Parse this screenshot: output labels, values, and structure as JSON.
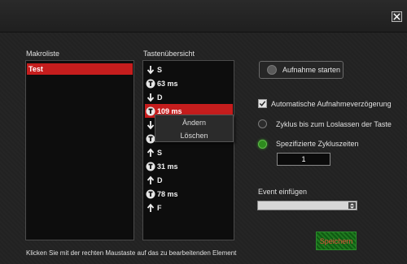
{
  "window": {
    "close_icon": "close-icon"
  },
  "makroliste": {
    "label": "Makroliste",
    "items": [
      "Test"
    ]
  },
  "tasten": {
    "label": "Tastenübersicht",
    "rows": [
      {
        "icon": "arrow-down-icon",
        "text": "S"
      },
      {
        "icon": "timer-icon",
        "text": "63 ms"
      },
      {
        "icon": "arrow-down-icon",
        "text": "D"
      },
      {
        "icon": "timer-icon",
        "text": "109 ms",
        "selected": true
      },
      {
        "icon": "arrow-down-icon",
        "text": ""
      },
      {
        "icon": "timer-icon",
        "text": ""
      },
      {
        "icon": "arrow-up-icon",
        "text": "S"
      },
      {
        "icon": "timer-icon",
        "text": "31 ms"
      },
      {
        "icon": "arrow-up-icon",
        "text": "D"
      },
      {
        "icon": "timer-icon",
        "text": "78 ms"
      },
      {
        "icon": "arrow-up-icon",
        "text": "F"
      }
    ]
  },
  "context_menu": {
    "edit": "Ändern",
    "delete": "Löschen"
  },
  "options": {
    "record_button": "Aufnahme starten",
    "auto_delay": "Automatische Aufnahmeverzögerung",
    "loop_until_release": "Zyklus bis zum Loslassen der Taste",
    "specified_cycles": "Spezifizierte Zykluszeiten",
    "cycles_value": "1",
    "event_label": "Event einfügen",
    "event_value": ""
  },
  "save_button": "Speichern",
  "footer_hint": "Klicken Sie mit der rechten Maustaste auf das zu bearbeitenden Element",
  "colors": {
    "accent_red": "#c51d1d",
    "accent_green": "#2e8b1e"
  }
}
